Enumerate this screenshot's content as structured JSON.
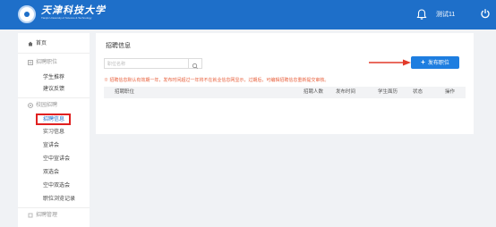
{
  "header": {
    "brand_cn": "天津科技大学",
    "brand_en": "Tianjin University of Science & Technology",
    "username": "测试11"
  },
  "sidebar": {
    "home": "首页",
    "groups": [
      {
        "label": "招聘职位",
        "items": [
          "学生推荐",
          "建议反馈"
        ]
      },
      {
        "label": "校园招聘",
        "items": [
          "招聘信息",
          "实习信息",
          "宣讲会",
          "空中宣讲会",
          "双选会",
          "空中双选会",
          "职位浏览记录"
        ]
      },
      {
        "label": "招聘管理",
        "items": []
      }
    ],
    "active_item": "招聘信息"
  },
  "main": {
    "title": "招聘信息",
    "search_placeholder": "职位名称",
    "publish_label": "发布职位",
    "notice": "※ 招聘信息默认有效期一年，发布时间超过一年将不在就业信息网显示，过期后，可编辑招聘信息重新提交审核。",
    "columns": [
      "招聘职位",
      "招聘人数",
      "发布时间",
      "学生面历",
      "状态",
      "操作"
    ]
  },
  "colors": {
    "topbar": "#1e6fc9",
    "accent": "#1e7ee0",
    "notice": "#e8603c",
    "highlight": "#e02020"
  }
}
